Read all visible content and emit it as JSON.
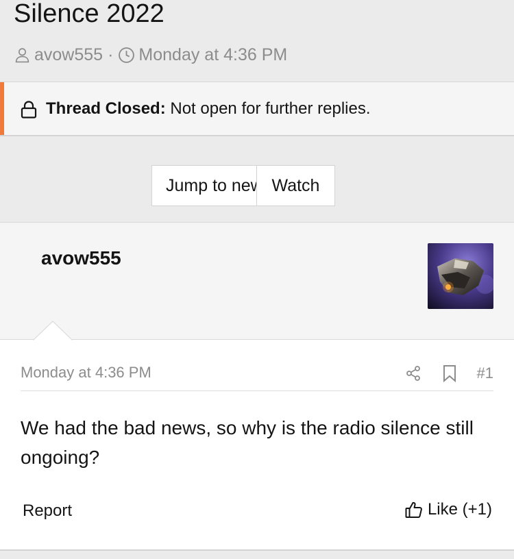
{
  "thread": {
    "title": "Silence 2022",
    "author": "avow555",
    "separator": "·",
    "date": "Monday at 4:36 PM"
  },
  "notice": {
    "label": "Thread Closed:",
    "message": "Not open for further replies."
  },
  "buttons": {
    "jump_to_new": "Jump to new",
    "watch": "Watch"
  },
  "post": {
    "username": "avow555",
    "date": "Monday at 4:36 PM",
    "number": "#1",
    "body": "We had the bad news, so why is the radio silence still ongoing?",
    "report_label": "Report",
    "like_label": "Like (+1)"
  },
  "colors": {
    "accent": "#f0793c",
    "page_bg": "#ebebeb",
    "muted_text": "#8c8c8c"
  },
  "icons": {
    "author": "user-icon",
    "date": "clock-icon",
    "notice": "lock-icon",
    "share": "share-icon",
    "bookmark": "bookmark-icon",
    "like": "thumbs-up-icon"
  }
}
